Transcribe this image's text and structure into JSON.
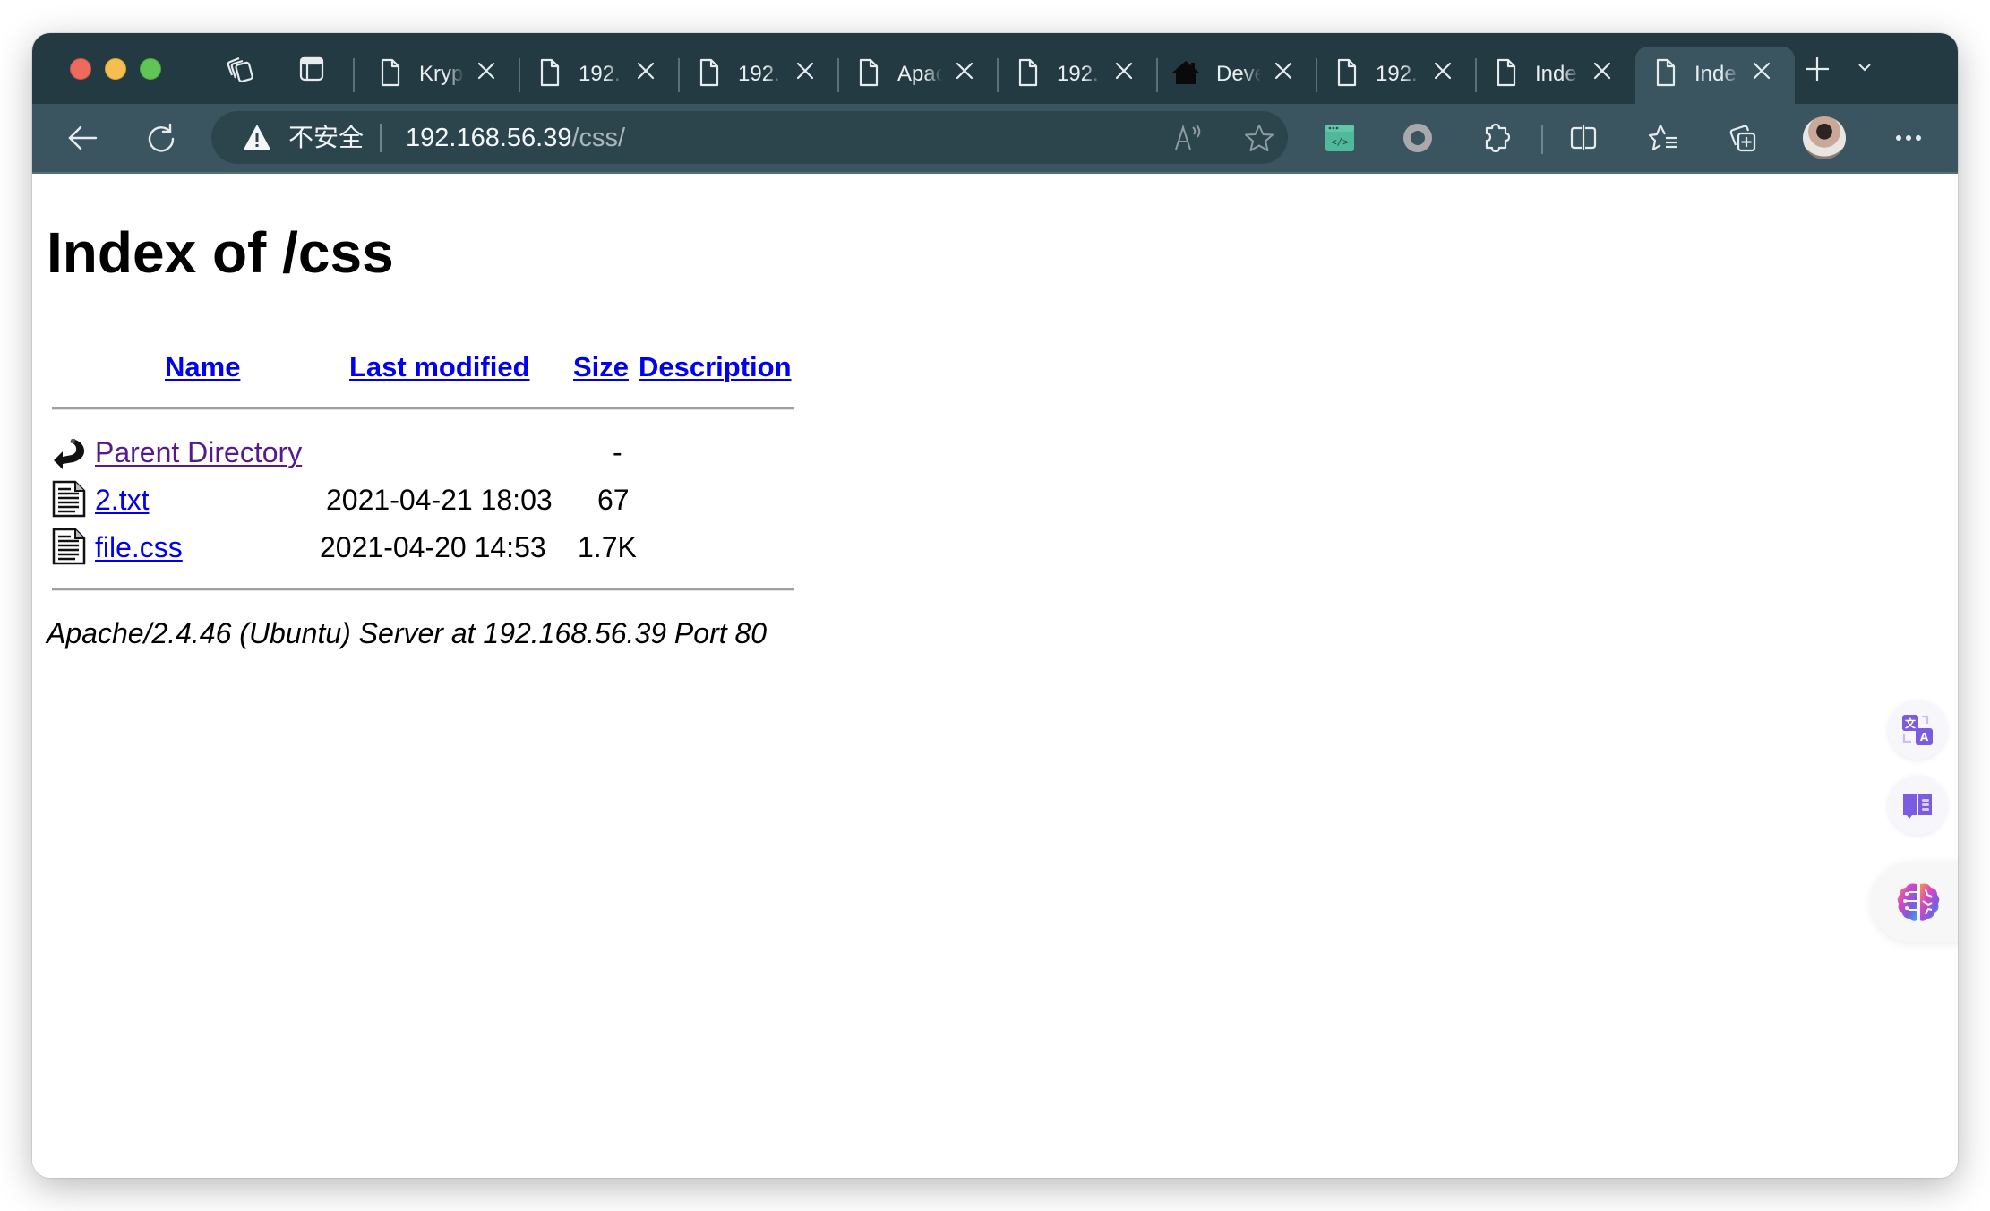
{
  "browser": {
    "tabs": [
      {
        "title": "Kryp",
        "icon": "page-icon"
      },
      {
        "title": "192.",
        "icon": "page-icon"
      },
      {
        "title": "192.",
        "icon": "page-icon"
      },
      {
        "title": "Apac",
        "icon": "page-icon"
      },
      {
        "title": "192.",
        "icon": "page-icon"
      },
      {
        "title": "Deve",
        "icon": "home-icon"
      },
      {
        "title": "192.",
        "icon": "page-icon"
      },
      {
        "title": "Inde",
        "icon": "page-icon"
      },
      {
        "title": "Inde",
        "icon": "page-icon",
        "active": true
      }
    ],
    "address_bar": {
      "security_label": "不安全",
      "url_host": "192.168.56.39",
      "url_path": "/css/"
    },
    "colors": {
      "tabbar": "#243a42",
      "toolbar": "#3a5560",
      "address_field": "#2c444c",
      "link": "#0000ee",
      "visited_link": "#551a8b",
      "side_accent": "#7b5ce0"
    }
  },
  "page": {
    "title": "Index of /css",
    "columns": {
      "name": "Name",
      "last_modified": "Last modified",
      "size": "Size",
      "description": "Description"
    },
    "rows": [
      {
        "name": "Parent Directory",
        "last_modified": "",
        "size": "-",
        "description": "",
        "icon": "back-arrow-icon",
        "visited": true
      },
      {
        "name": "2.txt",
        "last_modified": "2021-04-21 18:03",
        "size": "67",
        "description": "",
        "icon": "text-file-icon"
      },
      {
        "name": "file.css",
        "last_modified": "2021-04-20 14:53",
        "size": "1.7K",
        "description": "",
        "icon": "text-file-icon"
      }
    ],
    "server_signature": "Apache/2.4.46 (Ubuntu) Server at 192.168.56.39 Port 80"
  }
}
